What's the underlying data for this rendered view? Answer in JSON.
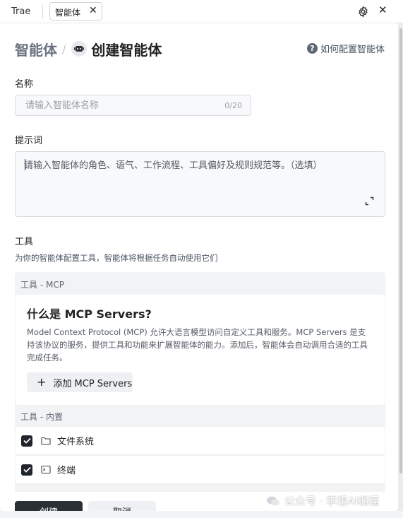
{
  "tabbar": {
    "app_name": "Trae",
    "active_tab": "智能体",
    "close_tab": "✕",
    "close_window": "✕"
  },
  "header": {
    "breadcrumb_root": "智能体",
    "breadcrumb_separator": "/",
    "title": "创建智能体",
    "help_link": "如何配置智能体",
    "help_icon_glyph": "?"
  },
  "form": {
    "name_label": "名称",
    "name_placeholder": "请输入智能体名称",
    "name_value": "",
    "name_counter": "0/20",
    "prompt_label": "提示词",
    "prompt_placeholder": "请输入智能体的角色、语气、工作流程、工具偏好及规则规范等。（选填）",
    "prompt_value": ""
  },
  "tools": {
    "label": "工具",
    "description": "为你的智能体配置工具，智能体将根据任务自动使用它们",
    "mcp_header": "工具 - MCP",
    "mcp_title": "什么是 MCP Servers?",
    "mcp_description": "Model Context Protocol (MCP) 允许大语言模型访问自定义工具和服务。MCP Servers 是支持该协议的服务，提供工具和功能来扩展智能体的能力。添加后，智能体会自动调用合适的工具完成任务。",
    "add_mcp_plus": "+",
    "add_mcp_label": "添加 MCP Servers",
    "builtin_header": "工具 - 内置",
    "builtin_items": [
      {
        "name": "文件系统",
        "checked": true,
        "icon": "folder-icon"
      },
      {
        "name": "终端",
        "checked": true,
        "icon": "terminal-icon"
      }
    ]
  },
  "footer": {
    "create_label": "创建",
    "cancel_label": "取消"
  },
  "watermark": {
    "text": "公众号 · 李想AI编程"
  },
  "colors": {
    "primary_button": "#2b2f36",
    "secondary_button": "#eef0f3",
    "panel_bg": "#ffffff",
    "tools_bg": "#f2f3f5",
    "muted_text": "#6b7280"
  }
}
